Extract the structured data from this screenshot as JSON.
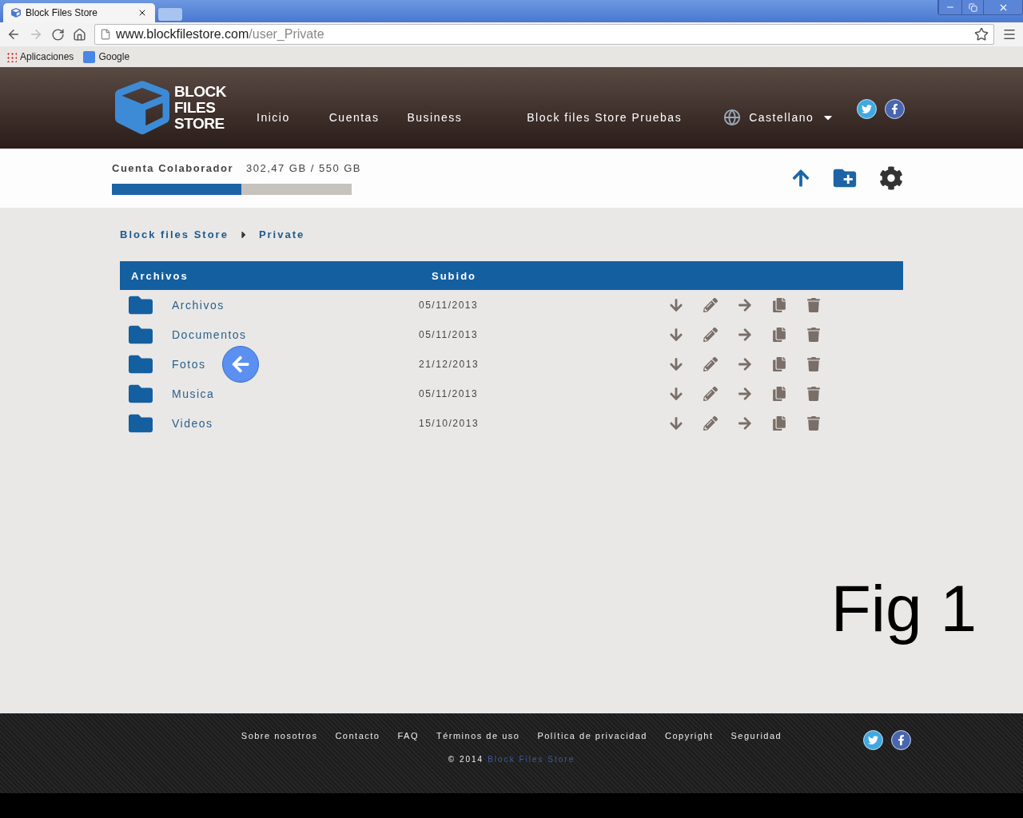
{
  "browser": {
    "tab_title": "Block Files Store",
    "url_host": "www.blockfilestore.com",
    "url_path": "/user_Private",
    "bookmarks": [
      {
        "label": "Aplicaciones",
        "kind": "apps"
      },
      {
        "label": "Google",
        "kind": "google"
      }
    ]
  },
  "header": {
    "logo_lines": [
      "BLOCK",
      "FILES",
      "STORE"
    ],
    "nav": [
      "Inicio",
      "Cuentas",
      "Business"
    ],
    "site_name": "Block files Store Pruebas",
    "language": "Castellano"
  },
  "account": {
    "label": "Cuenta Colaborador",
    "usage": "302,47 GB / 550 GB",
    "level": 0.54
  },
  "breadcrumb": [
    "Block files Store",
    "Private"
  ],
  "table": {
    "columns": [
      "Archivos",
      "Subido"
    ],
    "rows": [
      {
        "name": "Archivos",
        "date": "05/11/2013",
        "pointed": false
      },
      {
        "name": "Documentos",
        "date": "05/11/2013",
        "pointed": false
      },
      {
        "name": "Fotos",
        "date": "21/12/2013",
        "pointed": true
      },
      {
        "name": "Musica",
        "date": "05/11/2013",
        "pointed": false
      },
      {
        "name": "Videos",
        "date": "15/10/2013",
        "pointed": false
      }
    ]
  },
  "annotation": "Fig 1",
  "footer": {
    "links": [
      "Sobre nosotros",
      "Contacto",
      "FAQ",
      "Términos de uso",
      "Política de privacidad",
      "Copyright",
      "Seguridad"
    ],
    "copyright": "© 2014",
    "copyright_link": "Block Files Store"
  }
}
